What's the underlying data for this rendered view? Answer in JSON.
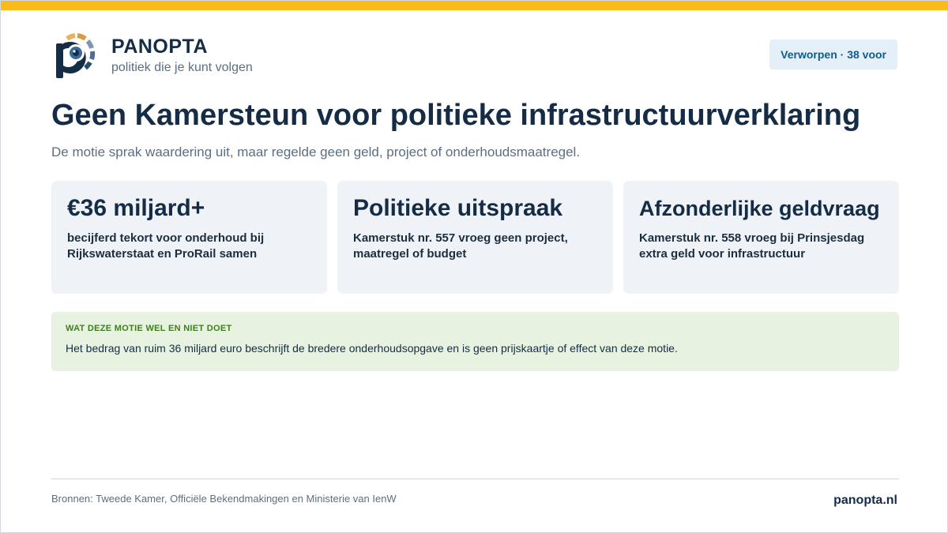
{
  "brand": {
    "name": "PANOPTA",
    "tagline": "politiek die je kunt volgen",
    "logo_icon": "panopta-eye-logo"
  },
  "status": {
    "label": "Verworpen · 38 voor"
  },
  "headline": {
    "title": "Geen Kamersteun voor politieke infrastructuurverklaring",
    "subtitle": "De motie sprak waardering uit, maar regelde geen geld, project of onderhoudsmaatregel."
  },
  "stats": [
    {
      "value": "€36 miljard+",
      "description": "becijferd tekort voor onderhoud bij Rijkswaterstaat en ProRail samen"
    },
    {
      "value": "Politieke uitspraak",
      "description": "Kamerstuk nr. 557 vroeg geen project, maatregel of budget"
    },
    {
      "value": "Afzonderlijke geldvraag",
      "description": "Kamerstuk nr. 558 vroeg bij Prinsjesdag extra geld voor infrastructuur"
    }
  ],
  "note": {
    "label": "WAT DEZE MOTIE WEL EN NIET DOET",
    "text": "Het bedrag van ruim 36 miljard euro beschrijft de bredere onderhoudsopgave en is geen prijskaartje of effect van deze motie."
  },
  "footer": {
    "sources": "Bronnen: Tweede Kamer, Officiële Bekendmakingen en Ministerie van IenW",
    "site": "panopta.nl"
  },
  "colors": {
    "accent_bar": "#fbb91c",
    "navy": "#142c46",
    "badge_bg": "#e4eff8",
    "badge_text": "#0e5e8c",
    "card_bg": "#eff3f7",
    "note_bg": "#e7f2e1",
    "note_label": "#3e7f1d"
  }
}
